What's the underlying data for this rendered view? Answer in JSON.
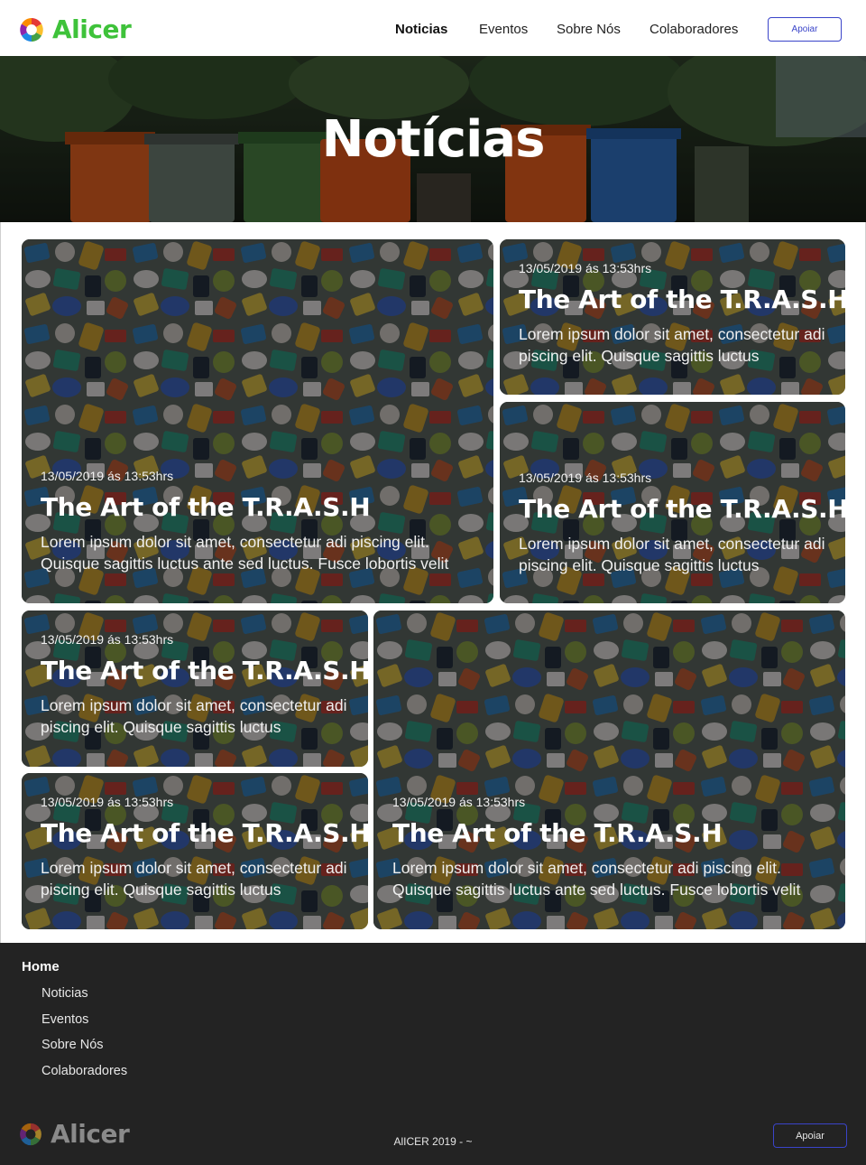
{
  "brand": {
    "name": "Alicer",
    "logo_colors": [
      "#e53935",
      "#fbc02d",
      "#43a047",
      "#1e88e5",
      "#8e24aa",
      "#fb8c00"
    ]
  },
  "nav": {
    "items": [
      {
        "label": "Noticias",
        "active": true
      },
      {
        "label": "Eventos",
        "active": false
      },
      {
        "label": "Sobre Nós",
        "active": false
      },
      {
        "label": "Colaboradores",
        "active": false
      }
    ],
    "support_label": "Apoiar"
  },
  "hero": {
    "title": "Notícias"
  },
  "news": [
    {
      "date": "13/05/2019 ás 13:53hrs",
      "title": "The Art of the T.R.A.S.H",
      "text": "Lorem ipsum dolor sit amet, consectetur adi piscing elit. Quisque sagittis luctus ante sed luctus. Fusce lobortis velit"
    },
    {
      "date": "13/05/2019 ás 13:53hrs",
      "title": "The Art of the T.R.A.S.H",
      "text": "Lorem ipsum dolor sit amet, consectetur adi piscing elit. Quisque sagittis luctus"
    },
    {
      "date": "13/05/2019 ás 13:53hrs",
      "title": "The Art of the T.R.A.S.H",
      "text": "Lorem ipsum dolor sit amet, consectetur adi piscing elit. Quisque sagittis luctus"
    },
    {
      "date": "13/05/2019 ás 13:53hrs",
      "title": "The Art of the T.R.A.S.H",
      "text": "Lorem ipsum dolor sit amet, consectetur adi piscing elit. Quisque sagittis luctus"
    },
    {
      "date": "13/05/2019 ás 13:53hrs",
      "title": "The Art of the T.R.A.S.H",
      "text": "Lorem ipsum dolor sit amet, consectetur adi piscing elit. Quisque sagittis luctus"
    },
    {
      "date": "13/05/2019 ás 13:53hrs",
      "title": "The Art of the T.R.A.S.H",
      "text": "Lorem ipsum dolor sit amet, consectetur adi piscing elit. Quisque sagittis luctus ante sed luctus. Fusce lobortis velit"
    }
  ],
  "footer": {
    "home_label": "Home",
    "links": [
      "Noticias",
      "Eventos",
      "Sobre Nós",
      "Colaboradores"
    ],
    "brand_name": "Alicer",
    "copyright": "AlICER 2019 - ~",
    "support_label": "Apoiar"
  },
  "colors": {
    "brand_green": "#3ec23a",
    "button_border": "#3a44c9",
    "footer_bg": "#232323"
  }
}
